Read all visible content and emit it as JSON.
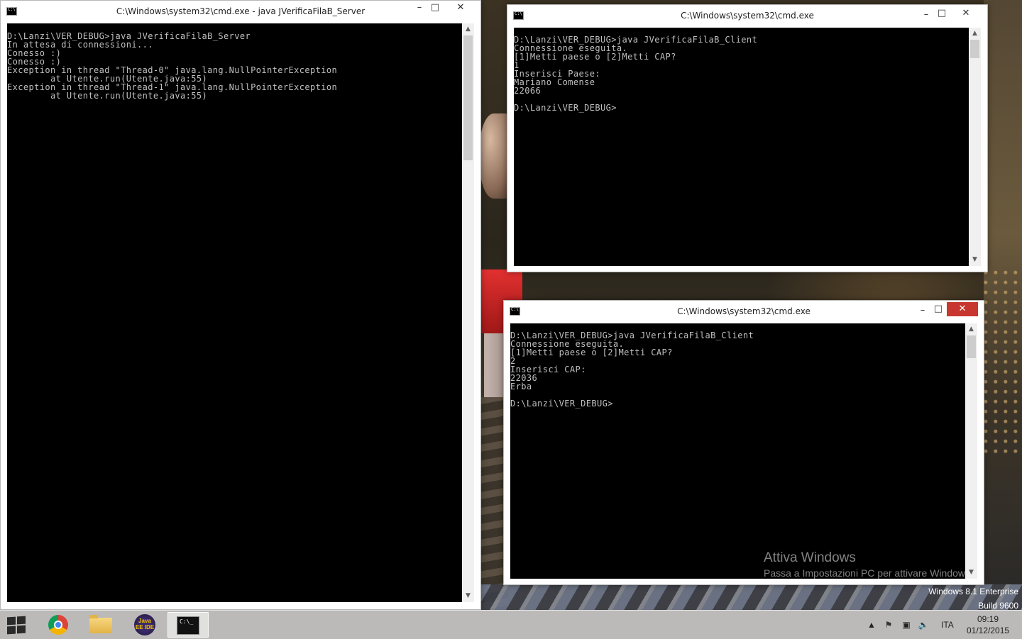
{
  "server_window": {
    "title": "C:\\Windows\\system32\\cmd.exe - java  JVerificaFilaB_Server",
    "lines": [
      "D:\\Lanzi\\VER_DEBUG>java JVerificaFilaB_Server",
      "In attesa di connessioni...",
      "Conesso :)",
      "Conesso :)",
      "Exception in thread \"Thread-0\" java.lang.NullPointerException",
      "        at Utente.run(Utente.java:55)",
      "Exception in thread \"Thread-1\" java.lang.NullPointerException",
      "        at Utente.run(Utente.java:55)"
    ]
  },
  "client_window_1": {
    "title": "C:\\Windows\\system32\\cmd.exe",
    "lines": [
      "D:\\Lanzi\\VER_DEBUG>java JVerificaFilaB_Client",
      "Connessione eseguita.",
      "[1]Metti paese o [2]Metti CAP?",
      "1",
      "Inserisci Paese:",
      "Mariano Comense",
      "22066",
      "",
      "D:\\Lanzi\\VER_DEBUG>"
    ]
  },
  "client_window_2": {
    "title": "C:\\Windows\\system32\\cmd.exe",
    "lines": [
      "D:\\Lanzi\\VER_DEBUG>java JVerificaFilaB_Client",
      "Connessione eseguita.",
      "[1]Metti paese o [2]Metti CAP?",
      "2",
      "Inserisci CAP:",
      "22036",
      "Erba",
      "",
      "D:\\Lanzi\\VER_DEBUG>"
    ]
  },
  "window_buttons": {
    "minimize": "–",
    "maximize": "□",
    "close": "✕"
  },
  "watermark": {
    "line1": "Attiva Windows",
    "line2": "Passa a Impostazioni PC per attivare Windows."
  },
  "edition": {
    "line1": "Windows 8.1 Enterprise",
    "line2": "Build 9600"
  },
  "taskbar": {
    "apps": [
      {
        "name": "chrome",
        "icon": "chrome-icon"
      },
      {
        "name": "file-explorer",
        "icon": "folder-icon"
      },
      {
        "name": "eclipse",
        "icon": "eclipse-icon",
        "label": "Java EE IDE"
      },
      {
        "name": "cmd",
        "icon": "cmd-icon",
        "label": "C:\\_"
      }
    ],
    "tray": {
      "language": "ITA",
      "time": "09:19",
      "date": "01/12/2015"
    }
  },
  "colors": {
    "close_active": "#c7372f",
    "console_bg": "#000000",
    "console_text": "#c0c0c0"
  }
}
